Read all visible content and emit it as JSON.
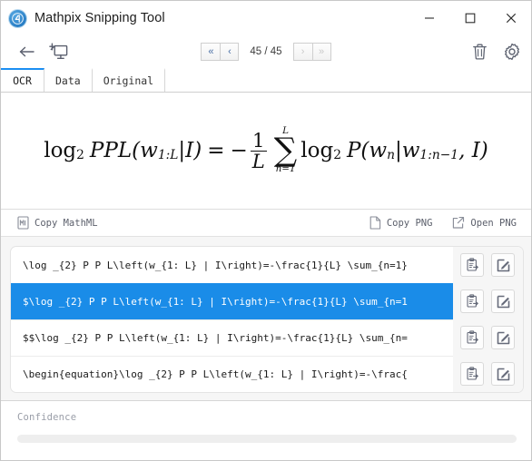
{
  "window": {
    "title": "Mathpix Snipping Tool",
    "logo_icon": "mathpix-logo-icon",
    "minimize_label": "–",
    "maximize_label": "□",
    "close_label": "✕"
  },
  "toolbar": {
    "back_icon": "arrow-left-icon",
    "snip_icon": "new-snip-screen-icon",
    "delete_icon": "trash-icon",
    "settings_icon": "gear-icon",
    "pager": {
      "first_label": "«",
      "prev_label": "‹",
      "next_label": "›",
      "last_label": "»",
      "current": "45",
      "separator": "/",
      "total": "45",
      "display": "45 / 45",
      "first_enabled": true,
      "prev_enabled": true,
      "next_enabled": false,
      "last_enabled": false
    }
  },
  "tabs": [
    {
      "label": "OCR",
      "active": true
    },
    {
      "label": "Data",
      "active": false
    },
    {
      "label": "Original",
      "active": false
    }
  ],
  "formula": {
    "latex_rendered": "log_2 PPL(w_{1:L}|I) = -\\frac{1}{L}\\sum_{n=1}^{L} log_2 P(w_n|w_{1:n-1}, I)",
    "parts": {
      "log": "log",
      "two": "2",
      "ppl": "PPL",
      "open": "(",
      "w": "w",
      "one_l": "1:L",
      "bar": "|",
      "i": "I",
      "close": ")",
      "equals": "=",
      "minus": "−",
      "num_one": "1",
      "den_l": "L",
      "sum_top": "L",
      "sum_glyph": "∑",
      "sum_bottom": "n=1",
      "p": "P",
      "w_sub_n": "n",
      "w_sub_range": "1:n−1",
      "comma_i": ", I"
    }
  },
  "copy_actions": {
    "mathml": {
      "label": "Copy MathML",
      "icon": "mathml-document-icon"
    },
    "copy_png": {
      "label": "Copy PNG",
      "icon": "copy-page-icon"
    },
    "open_png": {
      "label": "Open PNG",
      "icon": "open-external-icon"
    }
  },
  "results": {
    "copy_icon": "clipboard-copy-icon",
    "edit_icon": "edit-pencil-icon",
    "rows": [
      {
        "text": "\\log _{2} P P L\\left(w_{1: L} | I\\right)=-\\frac{1}{L} \\sum_{n=1}",
        "selected": false
      },
      {
        "text": "$\\log _{2} P P L\\left(w_{1: L} | I\\right)=-\\frac{1}{L} \\sum_{n=1",
        "selected": true
      },
      {
        "text": "$$\\log _{2} P P L\\left(w_{1: L} | I\\right)=-\\frac{1}{L} \\sum_{n=",
        "selected": false
      },
      {
        "text": "\\begin{equation}\\log _{2} P P L\\left(w_{1: L} | I\\right)=-\\frac{",
        "selected": false
      }
    ]
  },
  "confidence": {
    "label": "Confidence",
    "percent": 0
  },
  "colors": {
    "accent_blue": "#1a8ce8",
    "tab_active": "#1b8ef2",
    "logo_blue": "#2f8fd8",
    "panel_gray": "#f6f6f6"
  }
}
